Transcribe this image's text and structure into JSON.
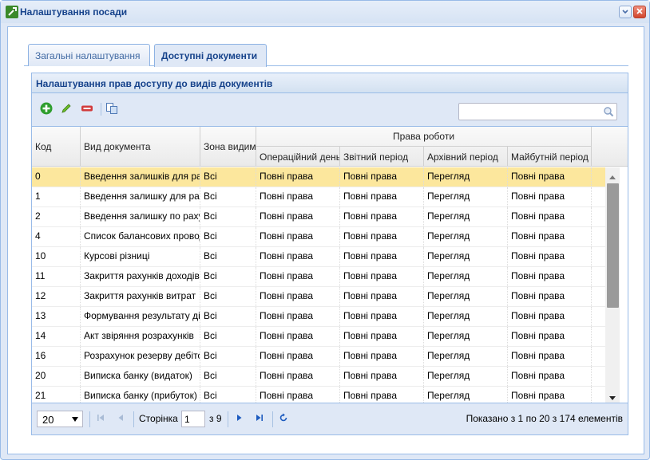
{
  "window": {
    "title": "Налаштування посади",
    "icon": "wrench-icon"
  },
  "tabs": [
    {
      "label": "Загальні налаштування",
      "active": false
    },
    {
      "label": "Доступні документи",
      "active": true
    }
  ],
  "panel": {
    "title": "Налаштування прав доступу до видів документів"
  },
  "toolbar": {
    "buttons": [
      "add-icon",
      "edit-icon",
      "delete-icon",
      "copy-icon"
    ],
    "search_placeholder": ""
  },
  "grid": {
    "headers": {
      "code": "Код",
      "doc_type": "Вид документа",
      "zone": "Зона видимості",
      "rights_group": "Права роботи",
      "operational": "Операційний день",
      "reporting": "Звітний період",
      "archive": "Архівний період",
      "future": "Майбутній період"
    },
    "rows": [
      {
        "code": "0",
        "doc_type": "Введення залишків для рахунків",
        "zone": "Всі",
        "operational": "Повні права",
        "reporting": "Повні права",
        "archive": "Перегляд",
        "future": "Повні права",
        "selected": true
      },
      {
        "code": "1",
        "doc_type": "Введення залишку для рахунку",
        "zone": "Всі",
        "operational": "Повні права",
        "reporting": "Повні права",
        "archive": "Перегляд",
        "future": "Повні права"
      },
      {
        "code": "2",
        "doc_type": "Введення залишку по рахунку",
        "zone": "Всі",
        "operational": "Повні права",
        "reporting": "Повні права",
        "archive": "Перегляд",
        "future": "Повні права"
      },
      {
        "code": "4",
        "doc_type": "Список балансових проводок",
        "zone": "Всі",
        "operational": "Повні права",
        "reporting": "Повні права",
        "archive": "Перегляд",
        "future": "Повні права"
      },
      {
        "code": "10",
        "doc_type": "Курсові різниці",
        "zone": "Всі",
        "operational": "Повні права",
        "reporting": "Повні права",
        "archive": "Перегляд",
        "future": "Повні права"
      },
      {
        "code": "11",
        "doc_type": "Закриття рахунків доходів",
        "zone": "Всі",
        "operational": "Повні права",
        "reporting": "Повні права",
        "archive": "Перегляд",
        "future": "Повні права"
      },
      {
        "code": "12",
        "doc_type": "Закриття рахунків витрат",
        "zone": "Всі",
        "operational": "Повні права",
        "reporting": "Повні права",
        "archive": "Перегляд",
        "future": "Повні права"
      },
      {
        "code": "13",
        "doc_type": "Формування результату діяльності",
        "zone": "Всі",
        "operational": "Повні права",
        "reporting": "Повні права",
        "archive": "Перегляд",
        "future": "Повні права"
      },
      {
        "code": "14",
        "doc_type": "Акт звіряння розрахунків",
        "zone": "Всі",
        "operational": "Повні права",
        "reporting": "Повні права",
        "archive": "Перегляд",
        "future": "Повні права"
      },
      {
        "code": "16",
        "doc_type": "Розрахунок резерву дебіторів",
        "zone": "Всі",
        "operational": "Повні права",
        "reporting": "Повні права",
        "archive": "Перегляд",
        "future": "Повні права"
      },
      {
        "code": "20",
        "doc_type": "Виписка банку (видаток)",
        "zone": "Всі",
        "operational": "Повні права",
        "reporting": "Повні права",
        "archive": "Перегляд",
        "future": "Повні права"
      },
      {
        "code": "21",
        "doc_type": "Виписка банку (прибуток)",
        "zone": "Всі",
        "operational": "Повні права",
        "reporting": "Повні права",
        "archive": "Перегляд",
        "future": "Повні права"
      }
    ]
  },
  "pager": {
    "page_size": "20",
    "page_label": "Сторінка",
    "page_value": "1",
    "of_label": "з 9",
    "info": "Показано з 1 по 20 з 174 елементів"
  },
  "colors": {
    "title": "#15428b",
    "border": "#99bbe8",
    "selection": "#fce79d"
  }
}
